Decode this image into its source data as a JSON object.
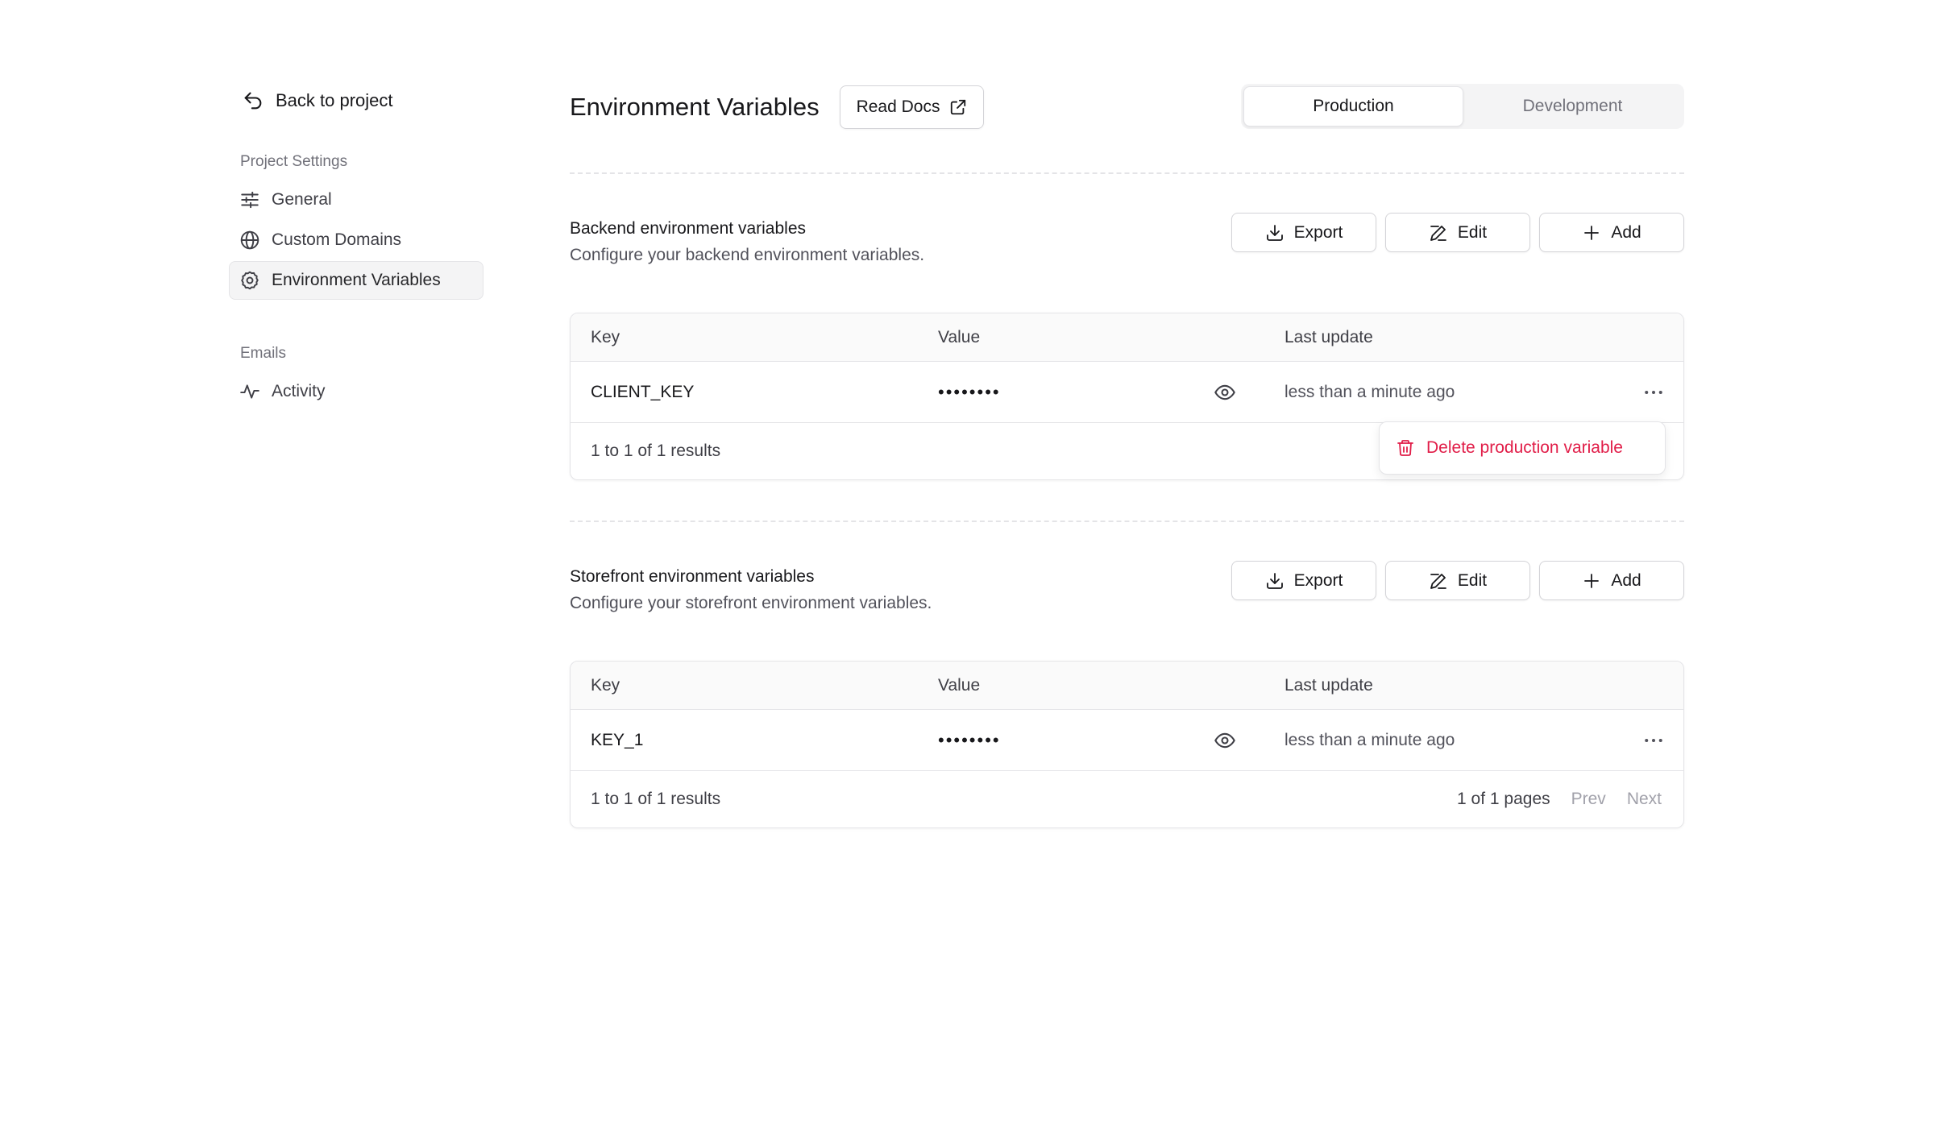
{
  "sidebar": {
    "back_label": "Back to project",
    "project_settings_label": "Project Settings",
    "items": [
      {
        "label": "General",
        "icon": "sliders-icon"
      },
      {
        "label": "Custom Domains",
        "icon": "globe-icon"
      },
      {
        "label": "Environment Variables",
        "icon": "gear-icon",
        "active": true
      }
    ],
    "emails_label": "Emails",
    "email_items": [
      {
        "label": "Activity",
        "icon": "activity-icon"
      }
    ]
  },
  "header": {
    "title": "Environment Variables",
    "docs_label": "Read Docs",
    "tabs": [
      {
        "label": "Production",
        "active": true
      },
      {
        "label": "Development",
        "active": false
      }
    ]
  },
  "backend": {
    "title": "Backend environment variables",
    "description": "Configure your backend environment variables.",
    "actions": {
      "export": "Export",
      "edit": "Edit",
      "add": "Add"
    },
    "columns": {
      "key": "Key",
      "value": "Value",
      "updated": "Last update"
    },
    "rows": [
      {
        "key": "CLIENT_KEY",
        "value": "••••••••",
        "updated": "less than a minute ago"
      }
    ],
    "results": "1 to 1 of 1 results",
    "menu": {
      "delete_label": "Delete production variable"
    }
  },
  "storefront": {
    "title": "Storefront environment variables",
    "description": "Configure your storefront environment variables.",
    "actions": {
      "export": "Export",
      "edit": "Edit",
      "add": "Add"
    },
    "columns": {
      "key": "Key",
      "value": "Value",
      "updated": "Last update"
    },
    "rows": [
      {
        "key": "KEY_1",
        "value": "••••••••",
        "updated": "less than a minute ago"
      }
    ],
    "results": "1 to 1 of 1 results",
    "pages": "1 of 1 pages",
    "prev": "Prev",
    "next": "Next"
  },
  "colors": {
    "danger": "#e11d48",
    "muted": "#71717a",
    "border": "#e4e4e7"
  }
}
